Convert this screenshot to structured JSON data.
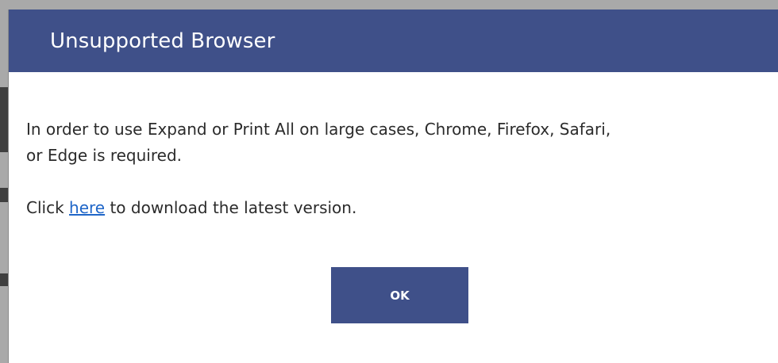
{
  "dialog": {
    "title": "Unsupported Browser",
    "message_line_1": "In order to use Expand or Print All on large cases, Chrome, Firefox, Safari,",
    "message_line_2": "or Edge is required.",
    "download_prefix": "Click ",
    "download_link": "here",
    "download_suffix": " to download the latest version.",
    "ok_label": "OK"
  },
  "colors": {
    "header_background": "#3f5089",
    "button_background": "#3f5089",
    "link": "#1f66c8",
    "backdrop": "#a9a9a9"
  }
}
